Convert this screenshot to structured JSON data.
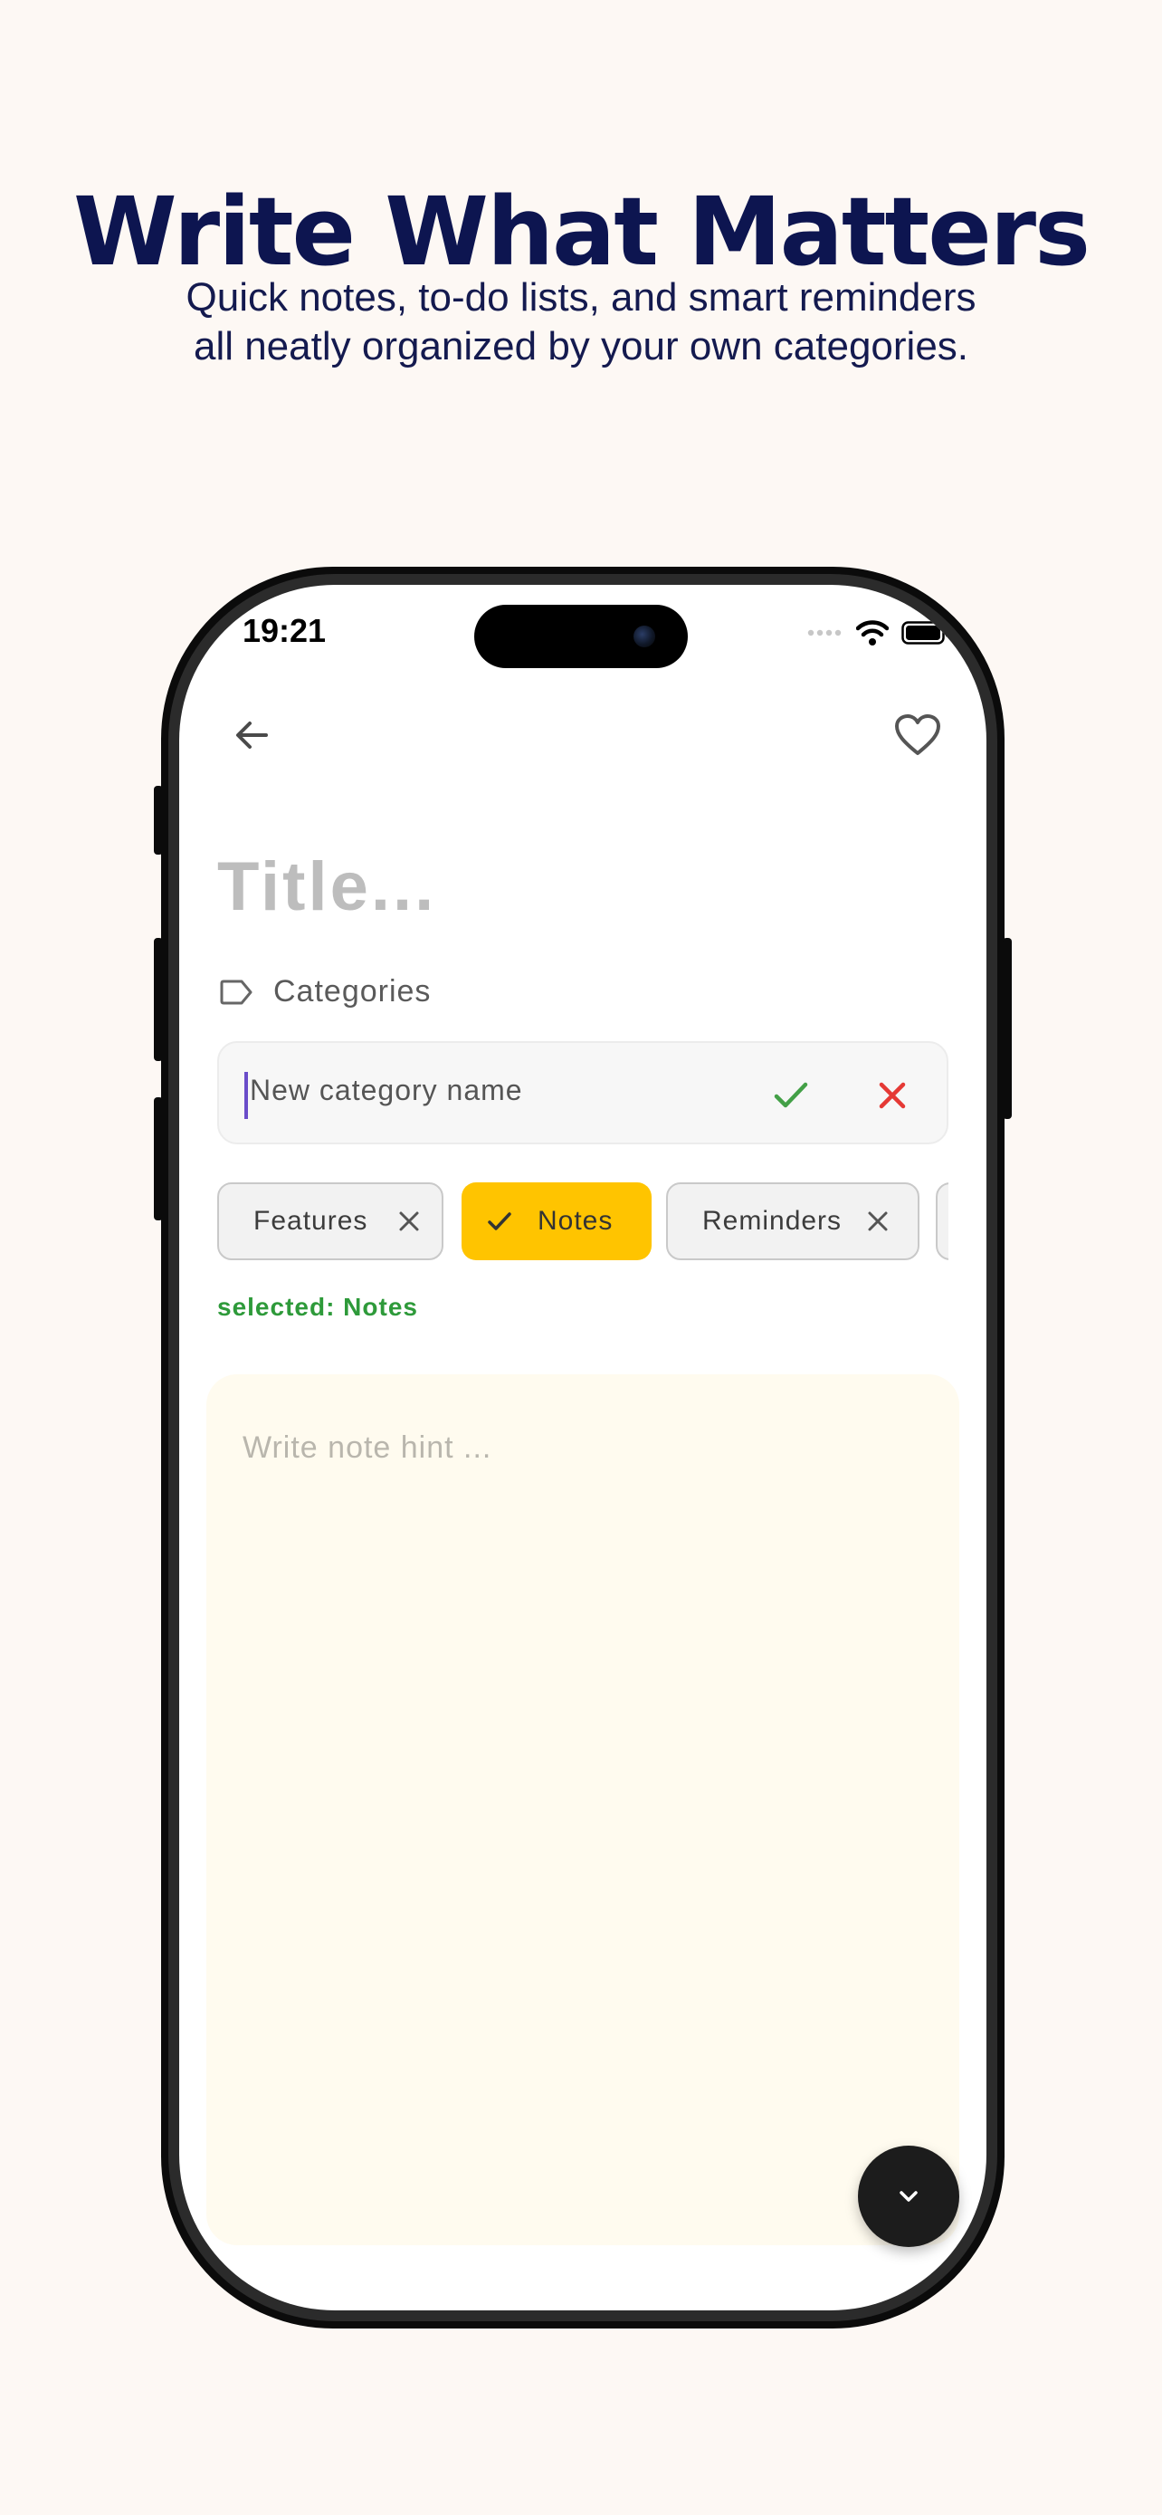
{
  "promo": {
    "headline": "Write What Matters",
    "subtitle_line1": "Quick notes, to-do lists, and smart reminders",
    "subtitle_line2": "all neatly organized by your own categories."
  },
  "status_bar": {
    "time": "19:21",
    "icons": [
      "cellular-icon",
      "wifi-icon",
      "battery-icon"
    ]
  },
  "toolbar": {
    "back_icon": "arrow-left-icon",
    "favorite_icon": "heart-outline-icon"
  },
  "editor": {
    "title_placeholder": "Title...",
    "categories_label": "Categories",
    "new_category_placeholder": "New category name",
    "chips": [
      {
        "label": "Features",
        "selected": false
      },
      {
        "label": "Notes",
        "selected": true
      },
      {
        "label": "Reminders",
        "selected": false
      }
    ],
    "selected_text": "selected: Notes",
    "note_hint": "Write note hint ..."
  },
  "colors": {
    "background": "#fdf8f4",
    "headline": "#0d1550",
    "chip_selected": "#ffc400",
    "confirm": "#43a047",
    "cancel": "#e53935",
    "selected_text": "#2e9a3a",
    "note_area": "#fffbef"
  }
}
